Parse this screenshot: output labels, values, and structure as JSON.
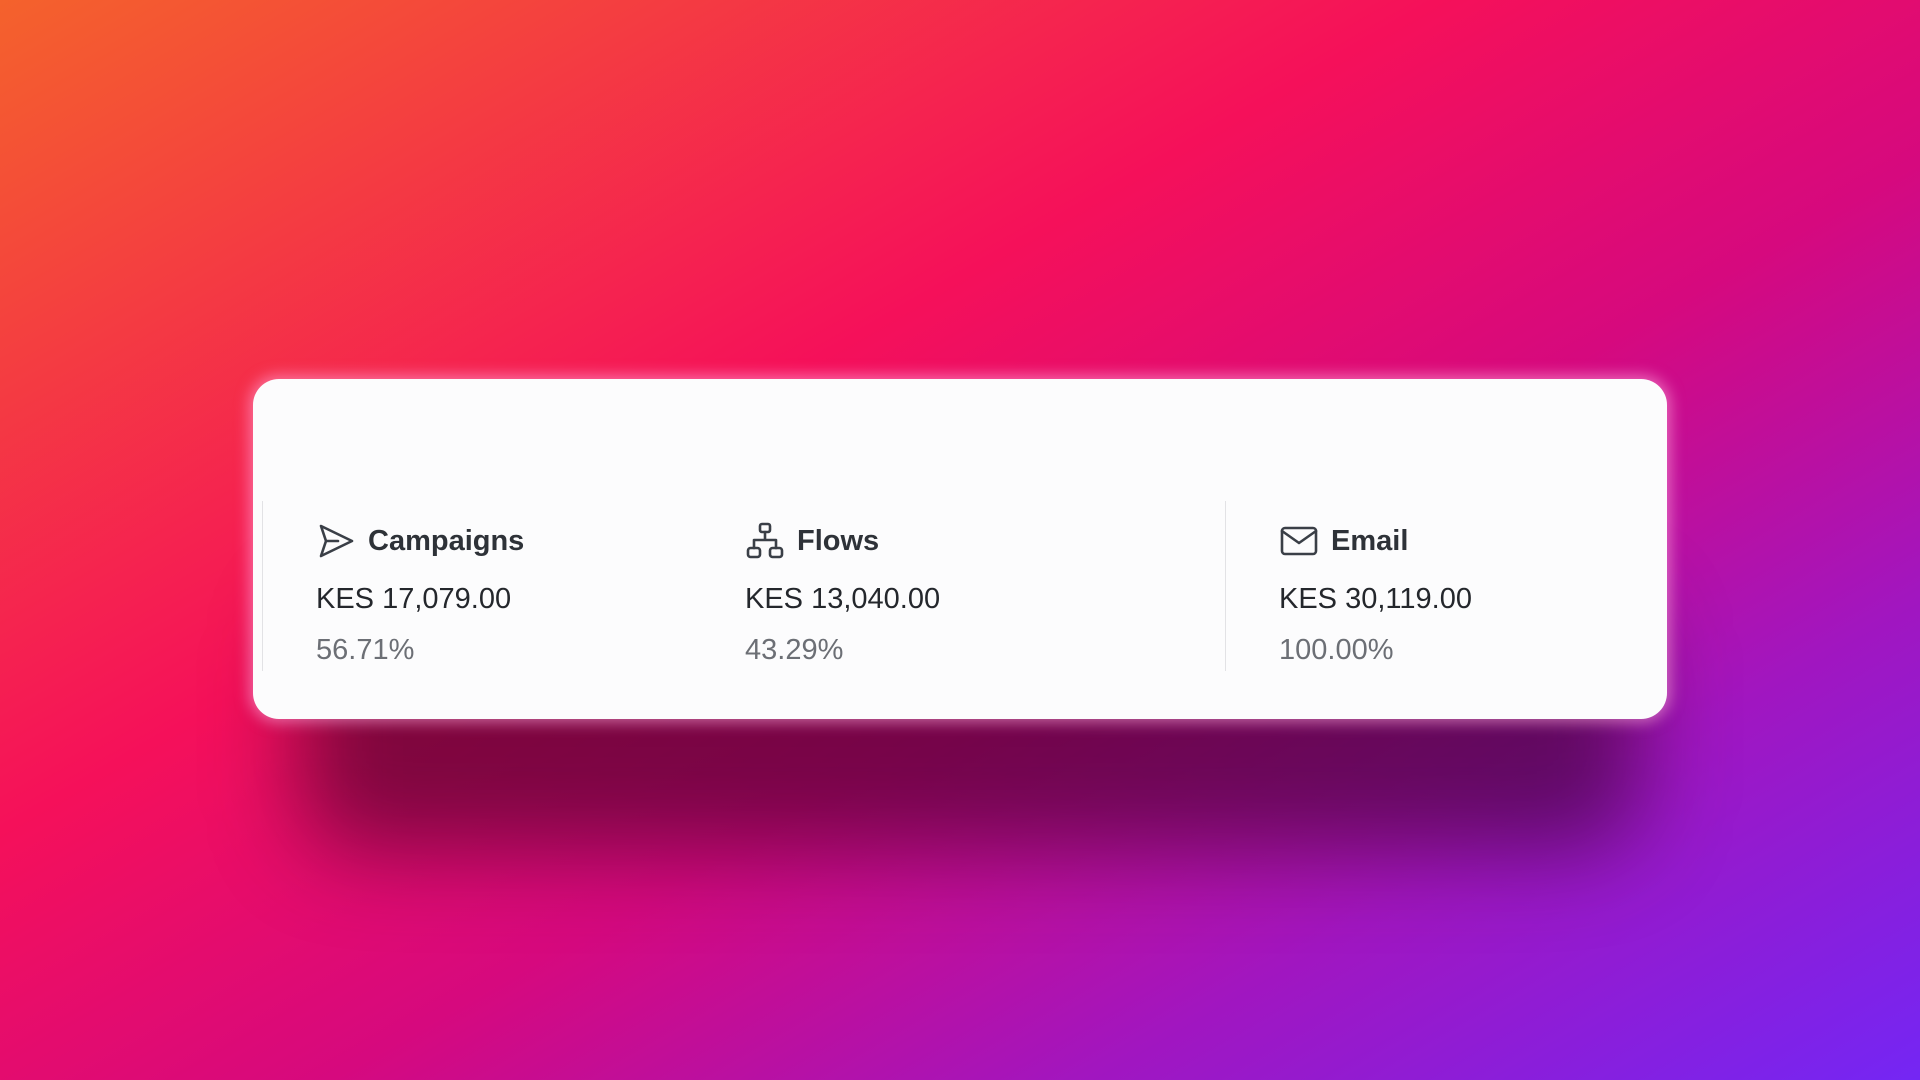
{
  "stats": [
    {
      "title": "Campaigns",
      "icon": "send-icon",
      "amount": "KES 17,079.00",
      "percent": "56.71%"
    },
    {
      "title": "Flows",
      "icon": "hierarchy-icon",
      "amount": "KES 13,040.00",
      "percent": "43.29%"
    },
    {
      "title": "Email",
      "icon": "mail-icon",
      "amount": "KES 30,119.00",
      "percent": "100.00%"
    }
  ],
  "colors": {
    "gradient_start": "#f4622c",
    "gradient_mid": "#f5105a",
    "gradient_end": "#7426f4",
    "card_background": "#fcfcfd"
  }
}
